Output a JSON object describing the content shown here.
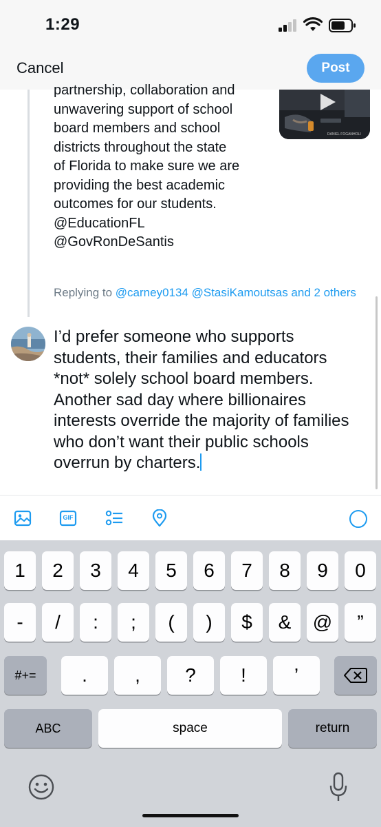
{
  "status_bar": {
    "time": "1:29"
  },
  "header": {
    "cancel_label": "Cancel",
    "post_label": "Post"
  },
  "quoted_tweet": {
    "lines": [
      "partnership, collaboration and",
      "unwavering support of school",
      "board members and school",
      "districts throughout the state",
      "of Florida to make sure we are",
      "providing the best academic",
      "outcomes for our students.",
      "@EducationFL",
      "@GovRonDeSantis"
    ],
    "media_caption": "DANIEL FOGANHOLI"
  },
  "replying": {
    "prefix": "Replying to ",
    "handles": "@carney0134 @StasiKamoutsas and 2 others"
  },
  "reply": {
    "text": "I’d prefer someone who supports students, their families and educators *not* solely school board members. Another sad day where billionaires interests override the majority of families who don’t want their public schools overrun by charters."
  },
  "toolbar": {
    "icons": [
      "image-icon",
      "gif-icon",
      "poll-icon",
      "location-icon",
      "character-count-ring"
    ],
    "gif_label": "GIF"
  },
  "keyboard": {
    "row1": [
      "1",
      "2",
      "3",
      "4",
      "5",
      "6",
      "7",
      "8",
      "9",
      "0"
    ],
    "row2": [
      "-",
      "/",
      ":",
      ";",
      "(",
      ")",
      "$",
      "&",
      "@",
      "”"
    ],
    "row3": [
      ".",
      ",",
      "?",
      "!",
      "’"
    ],
    "symbols_label": "#+=",
    "abc_label": "ABC",
    "space_label": "space",
    "return_label": "return"
  },
  "colors": {
    "accent": "#1d9bf0",
    "post_button": "#5aa7ef",
    "keyboard_bg": "#d1d4d9",
    "key_dark": "#abb0ba"
  }
}
